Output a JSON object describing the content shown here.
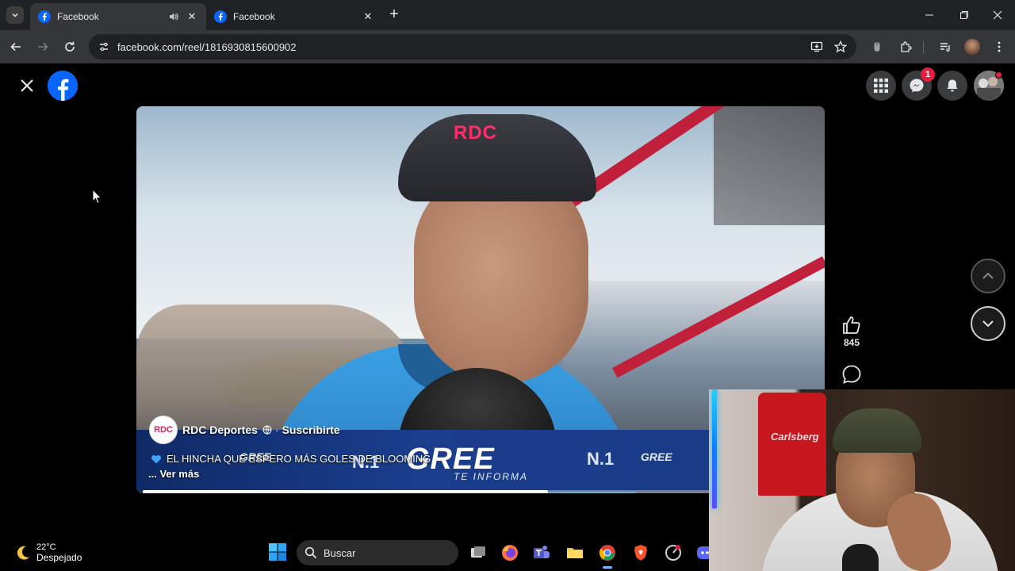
{
  "browser": {
    "tabs": [
      {
        "title": "Facebook",
        "active": true,
        "audio": true
      },
      {
        "title": "Facebook",
        "active": false,
        "audio": false
      }
    ],
    "url": "facebook.com/reel/1816930815600902"
  },
  "facebook": {
    "messenger_badge": "1"
  },
  "reel": {
    "channel_avatar_text": "RDC",
    "channel_name": "RDC Deportes",
    "separator": "·",
    "subscribe_label": "Suscribirte",
    "caption": "EL HINCHA QUE ESPERO MÁS GOLES DE BLOOMING",
    "see_more": "... Ver más",
    "cap_logo": "RDC",
    "progress": 0.6,
    "like_count": "845",
    "sponsor": {
      "brand": "GREE",
      "tagline": "TE INFORMA",
      "brand_small": "GREE",
      "rank": "N.1"
    }
  },
  "webcam": {
    "jersey_text": "Carlsberg"
  },
  "taskbar": {
    "temperature": "22°C",
    "condition": "Despejado",
    "search_placeholder": "Buscar"
  },
  "colors": {
    "facebook_blue": "#0866ff",
    "badge_red": "#e41e3f",
    "browser_dark": "#202124",
    "toolbar": "#35363a"
  }
}
